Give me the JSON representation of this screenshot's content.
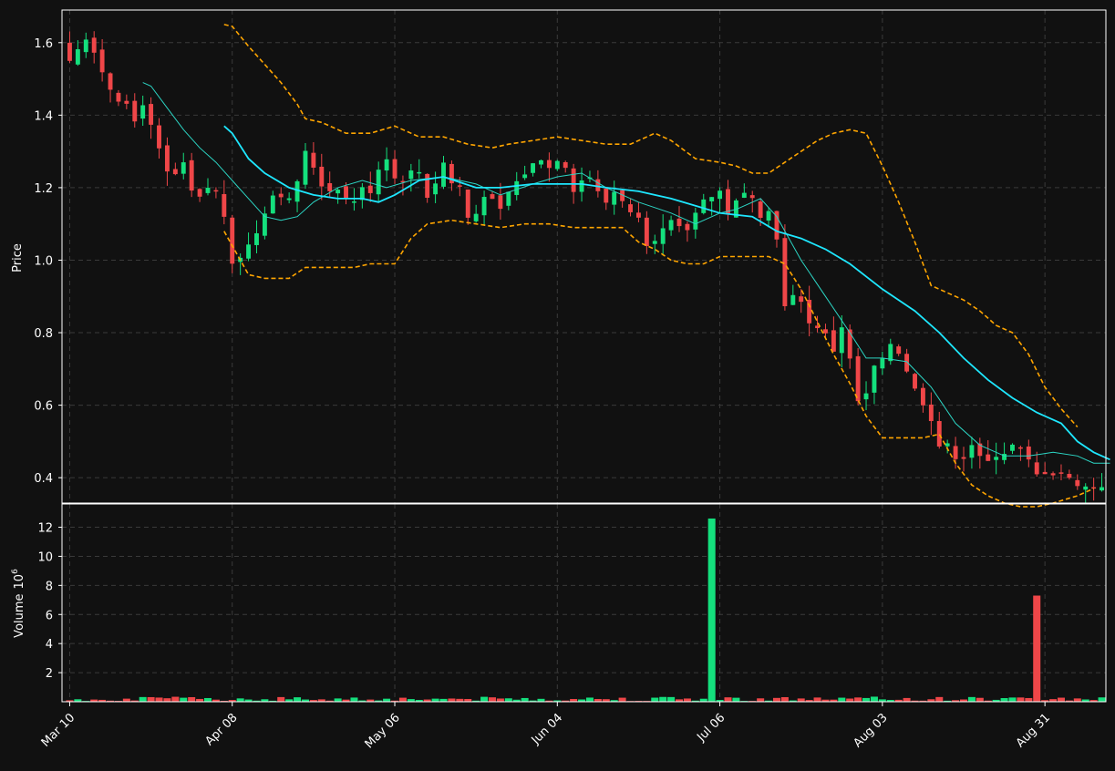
{
  "chart_data": {
    "type": "candlestick",
    "x_tick_labels": [
      "Mar 10",
      "Apr 08",
      "May 06",
      "Jun 04",
      "Jul 06",
      "Aug 03",
      "Aug 31"
    ],
    "x_tick_index": [
      0,
      20,
      40,
      60,
      80,
      100,
      120
    ],
    "price_axis": {
      "ylabel": "Price",
      "ylim": [
        0.33,
        1.69
      ],
      "ticks": [
        0.4,
        0.6,
        0.8,
        1.0,
        1.2,
        1.4,
        1.6
      ]
    },
    "volume_axis": {
      "ylabel": "Volume",
      "ylabel_exp": "6",
      "ylim": [
        0,
        13.6
      ],
      "ticks": [
        2,
        4,
        6,
        8,
        10,
        12
      ],
      "unit": "millions"
    },
    "grid": true,
    "colors": {
      "background": "#111111",
      "up": "#14e07d",
      "down": "#ef4648",
      "ma_slow": "#1ee7ff",
      "ma_fast": "#2cd5c4",
      "bands": "#ffa500",
      "grid": "#3a3a3a",
      "axis": "#ffffff"
    },
    "price_anchors": [
      [
        0,
        1.55
      ],
      [
        1,
        1.58
      ],
      [
        2,
        1.62
      ],
      [
        3,
        1.58
      ],
      [
        4,
        1.52
      ],
      [
        5,
        1.47
      ],
      [
        6,
        1.45
      ],
      [
        7,
        1.42
      ],
      [
        8,
        1.38
      ],
      [
        9,
        1.43
      ],
      [
        10,
        1.38
      ],
      [
        11,
        1.3
      ],
      [
        12,
        1.24
      ],
      [
        13,
        1.25
      ],
      [
        14,
        1.27
      ],
      [
        15,
        1.2
      ],
      [
        16,
        1.17
      ],
      [
        17,
        1.21
      ],
      [
        18,
        1.19
      ],
      [
        19,
        1.12
      ],
      [
        20,
        1.0
      ],
      [
        21,
        1.02
      ],
      [
        22,
        1.03
      ],
      [
        23,
        1.06
      ],
      [
        24,
        1.14
      ],
      [
        25,
        1.18
      ],
      [
        26,
        1.16
      ],
      [
        27,
        1.18
      ],
      [
        28,
        1.22
      ],
      [
        29,
        1.3
      ],
      [
        30,
        1.25
      ],
      [
        31,
        1.21
      ],
      [
        32,
        1.2
      ],
      [
        33,
        1.18
      ],
      [
        34,
        1.17
      ],
      [
        35,
        1.17
      ],
      [
        36,
        1.2
      ],
      [
        37,
        1.19
      ],
      [
        38,
        1.26
      ],
      [
        39,
        1.27
      ],
      [
        40,
        1.23
      ],
      [
        41,
        1.22
      ],
      [
        42,
        1.26
      ],
      [
        43,
        1.23
      ],
      [
        44,
        1.18
      ],
      [
        45,
        1.2
      ],
      [
        46,
        1.27
      ],
      [
        47,
        1.22
      ],
      [
        48,
        1.2
      ],
      [
        49,
        1.12
      ],
      [
        50,
        1.12
      ],
      [
        51,
        1.17
      ],
      [
        52,
        1.18
      ],
      [
        53,
        1.15
      ],
      [
        54,
        1.19
      ],
      [
        55,
        1.23
      ],
      [
        56,
        1.25
      ],
      [
        57,
        1.27
      ],
      [
        58,
        1.27
      ],
      [
        59,
        1.25
      ],
      [
        60,
        1.26
      ],
      [
        61,
        1.26
      ],
      [
        62,
        1.19
      ],
      [
        63,
        1.22
      ],
      [
        64,
        1.23
      ],
      [
        65,
        1.18
      ],
      [
        66,
        1.16
      ],
      [
        67,
        1.19
      ],
      [
        68,
        1.17
      ],
      [
        69,
        1.14
      ],
      [
        70,
        1.11
      ],
      [
        71,
        1.05
      ],
      [
        72,
        1.06
      ],
      [
        73,
        1.08
      ],
      [
        74,
        1.1
      ],
      [
        75,
        1.08
      ],
      [
        76,
        1.07
      ],
      [
        77,
        1.12
      ],
      [
        78,
        1.16
      ],
      [
        79,
        1.17
      ],
      [
        80,
        1.19
      ],
      [
        81,
        1.14
      ],
      [
        82,
        1.17
      ],
      [
        83,
        1.19
      ],
      [
        84,
        1.18
      ],
      [
        85,
        1.12
      ],
      [
        86,
        1.13
      ],
      [
        87,
        1.05
      ],
      [
        88,
        0.88
      ],
      [
        89,
        0.89
      ],
      [
        90,
        0.9
      ],
      [
        91,
        0.83
      ],
      [
        92,
        0.81
      ],
      [
        93,
        0.8
      ],
      [
        94,
        0.76
      ],
      [
        95,
        0.8
      ],
      [
        96,
        0.73
      ],
      [
        97,
        0.6
      ],
      [
        98,
        0.63
      ],
      [
        99,
        0.71
      ],
      [
        100,
        0.74
      ],
      [
        101,
        0.76
      ],
      [
        102,
        0.73
      ],
      [
        103,
        0.7
      ],
      [
        104,
        0.66
      ],
      [
        105,
        0.61
      ],
      [
        106,
        0.55
      ],
      [
        107,
        0.48
      ],
      [
        108,
        0.49
      ],
      [
        109,
        0.44
      ],
      [
        110,
        0.46
      ],
      [
        111,
        0.48
      ],
      [
        112,
        0.47
      ],
      [
        113,
        0.46
      ],
      [
        114,
        0.47
      ],
      [
        115,
        0.48
      ],
      [
        116,
        0.49
      ],
      [
        117,
        0.47
      ],
      [
        118,
        0.44
      ],
      [
        119,
        0.42
      ],
      [
        120,
        0.41
      ],
      [
        121,
        0.42
      ],
      [
        122,
        0.42
      ],
      [
        123,
        0.4
      ],
      [
        124,
        0.39
      ],
      [
        125,
        0.38
      ]
    ],
    "ma_slow": [
      [
        19,
        1.37
      ],
      [
        20,
        1.35
      ],
      [
        22,
        1.28
      ],
      [
        24,
        1.24
      ],
      [
        27,
        1.2
      ],
      [
        30,
        1.18
      ],
      [
        33,
        1.17
      ],
      [
        36,
        1.17
      ],
      [
        38,
        1.16
      ],
      [
        40,
        1.18
      ],
      [
        43,
        1.22
      ],
      [
        46,
        1.23
      ],
      [
        50,
        1.2
      ],
      [
        53,
        1.2
      ],
      [
        57,
        1.21
      ],
      [
        60,
        1.21
      ],
      [
        63,
        1.21
      ],
      [
        66,
        1.2
      ],
      [
        70,
        1.19
      ],
      [
        74,
        1.17
      ],
      [
        77,
        1.15
      ],
      [
        80,
        1.13
      ],
      [
        84,
        1.12
      ],
      [
        87,
        1.08
      ],
      [
        90,
        1.06
      ],
      [
        93,
        1.03
      ],
      [
        96,
        0.99
      ],
      [
        100,
        0.92
      ],
      [
        104,
        0.86
      ],
      [
        107,
        0.8
      ],
      [
        110,
        0.73
      ],
      [
        113,
        0.67
      ],
      [
        116,
        0.62
      ],
      [
        119,
        0.58
      ],
      [
        122,
        0.55
      ],
      [
        124,
        0.5
      ],
      [
        126,
        0.47
      ],
      [
        128,
        0.45
      ]
    ],
    "ma_fast": [
      [
        9,
        1.49
      ],
      [
        10,
        1.48
      ],
      [
        12,
        1.42
      ],
      [
        14,
        1.36
      ],
      [
        16,
        1.31
      ],
      [
        18,
        1.27
      ],
      [
        20,
        1.22
      ],
      [
        22,
        1.17
      ],
      [
        24,
        1.12
      ],
      [
        26,
        1.11
      ],
      [
        28,
        1.12
      ],
      [
        30,
        1.16
      ],
      [
        33,
        1.2
      ],
      [
        36,
        1.22
      ],
      [
        39,
        1.2
      ],
      [
        42,
        1.22
      ],
      [
        46,
        1.23
      ],
      [
        50,
        1.21
      ],
      [
        53,
        1.18
      ],
      [
        57,
        1.21
      ],
      [
        60,
        1.23
      ],
      [
        63,
        1.24
      ],
      [
        66,
        1.2
      ],
      [
        70,
        1.16
      ],
      [
        74,
        1.13
      ],
      [
        77,
        1.1
      ],
      [
        80,
        1.13
      ],
      [
        82,
        1.14
      ],
      [
        85,
        1.17
      ],
      [
        87,
        1.12
      ],
      [
        90,
        1.0
      ],
      [
        93,
        0.9
      ],
      [
        96,
        0.8
      ],
      [
        98,
        0.73
      ],
      [
        100,
        0.73
      ],
      [
        103,
        0.72
      ],
      [
        106,
        0.65
      ],
      [
        109,
        0.55
      ],
      [
        112,
        0.49
      ],
      [
        115,
        0.46
      ],
      [
        118,
        0.46
      ],
      [
        121,
        0.47
      ],
      [
        124,
        0.46
      ],
      [
        126,
        0.44
      ],
      [
        128,
        0.44
      ]
    ],
    "band_upper": [
      [
        19,
        1.65
      ],
      [
        20,
        1.645
      ],
      [
        22,
        1.59
      ],
      [
        24,
        1.54
      ],
      [
        26,
        1.49
      ],
      [
        28,
        1.43
      ],
      [
        29,
        1.39
      ],
      [
        31,
        1.38
      ],
      [
        34,
        1.35
      ],
      [
        37,
        1.35
      ],
      [
        40,
        1.37
      ],
      [
        43,
        1.34
      ],
      [
        46,
        1.34
      ],
      [
        49,
        1.32
      ],
      [
        52,
        1.31
      ],
      [
        54,
        1.32
      ],
      [
        57,
        1.33
      ],
      [
        60,
        1.34
      ],
      [
        63,
        1.33
      ],
      [
        66,
        1.32
      ],
      [
        69,
        1.32
      ],
      [
        72,
        1.35
      ],
      [
        74,
        1.33
      ],
      [
        77,
        1.28
      ],
      [
        80,
        1.27
      ],
      [
        82,
        1.26
      ],
      [
        84,
        1.24
      ],
      [
        86,
        1.24
      ],
      [
        88,
        1.27
      ],
      [
        90,
        1.3
      ],
      [
        92,
        1.33
      ],
      [
        94,
        1.35
      ],
      [
        96,
        1.36
      ],
      [
        98,
        1.35
      ],
      [
        100,
        1.26
      ],
      [
        102,
        1.16
      ],
      [
        104,
        1.05
      ],
      [
        106,
        0.93
      ],
      [
        108,
        0.91
      ],
      [
        110,
        0.89
      ],
      [
        112,
        0.86
      ],
      [
        114,
        0.82
      ],
      [
        116,
        0.8
      ],
      [
        118,
        0.74
      ],
      [
        120,
        0.65
      ],
      [
        122,
        0.59
      ],
      [
        124,
        0.54
      ]
    ],
    "band_lower": [
      [
        19,
        1.08
      ],
      [
        20,
        1.04
      ],
      [
        21,
        1.0
      ],
      [
        22,
        0.96
      ],
      [
        24,
        0.95
      ],
      [
        27,
        0.95
      ],
      [
        29,
        0.98
      ],
      [
        32,
        0.98
      ],
      [
        35,
        0.98
      ],
      [
        37,
        0.99
      ],
      [
        40,
        0.99
      ],
      [
        42,
        1.06
      ],
      [
        44,
        1.1
      ],
      [
        47,
        1.11
      ],
      [
        50,
        1.1
      ],
      [
        53,
        1.09
      ],
      [
        56,
        1.1
      ],
      [
        59,
        1.1
      ],
      [
        62,
        1.09
      ],
      [
        65,
        1.09
      ],
      [
        68,
        1.09
      ],
      [
        70,
        1.05
      ],
      [
        72,
        1.03
      ],
      [
        74,
        1.0
      ],
      [
        76,
        0.99
      ],
      [
        78,
        0.99
      ],
      [
        80,
        1.01
      ],
      [
        83,
        1.01
      ],
      [
        86,
        1.01
      ],
      [
        88,
        0.99
      ],
      [
        90,
        0.92
      ],
      [
        92,
        0.83
      ],
      [
        94,
        0.74
      ],
      [
        96,
        0.66
      ],
      [
        98,
        0.57
      ],
      [
        100,
        0.51
      ],
      [
        103,
        0.51
      ],
      [
        105,
        0.51
      ],
      [
        107,
        0.52
      ],
      [
        109,
        0.44
      ],
      [
        111,
        0.38
      ],
      [
        113,
        0.35
      ],
      [
        115,
        0.33
      ],
      [
        117,
        0.32
      ],
      [
        119,
        0.32
      ],
      [
        121,
        0.33
      ],
      [
        124,
        0.35
      ],
      [
        126,
        0.37
      ]
    ],
    "volume_spikes": [
      [
        79,
        12.6,
        "up"
      ],
      [
        119,
        7.3,
        "down"
      ]
    ]
  }
}
